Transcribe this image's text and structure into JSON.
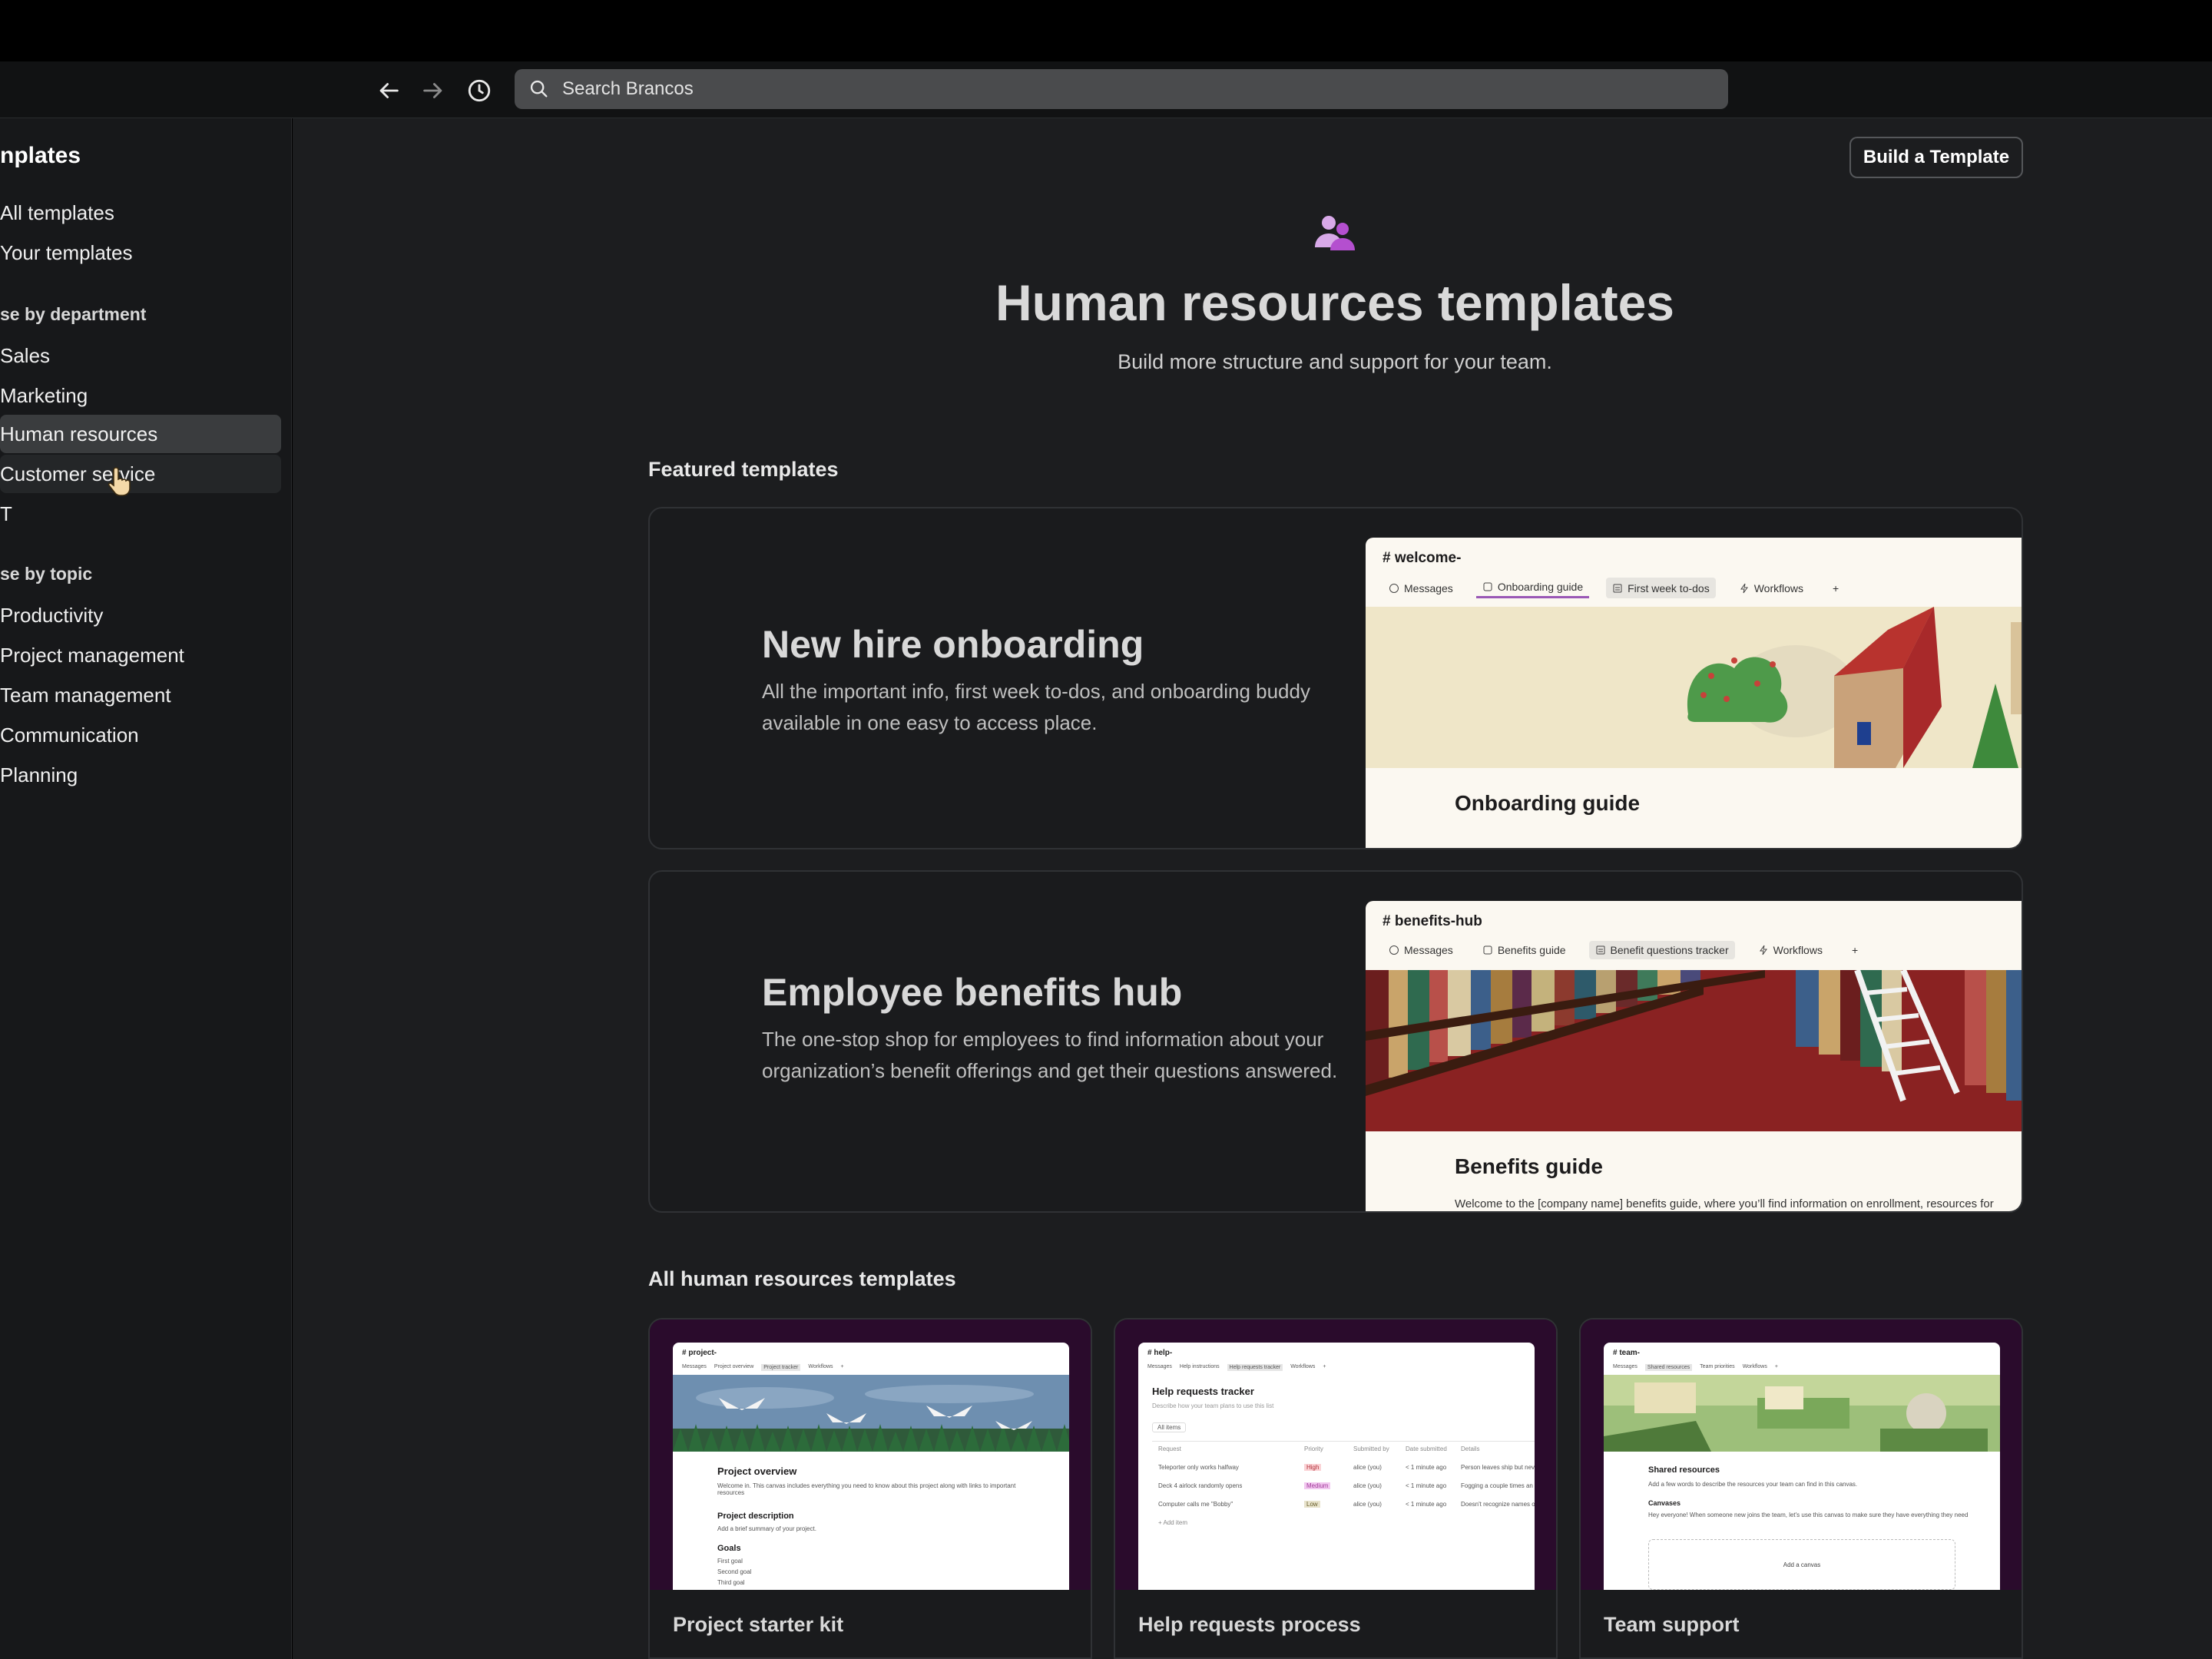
{
  "toolbar": {
    "search_placeholder": "Search Brancos"
  },
  "sidebar": {
    "title": "nplates",
    "top_items": [
      "All templates",
      "Your templates"
    ],
    "dept_heading": "se by department",
    "dept_items": [
      "Sales",
      "Marketing",
      "Human resources",
      "Customer service",
      "T"
    ],
    "topic_heading": "se by topic",
    "topic_items": [
      "Productivity",
      "Project management",
      "Team management",
      "Communication",
      "Planning"
    ]
  },
  "header": {
    "build_button": "Build a Template",
    "hero_icon": "people-icon",
    "title": "Human resources templates",
    "subtitle": "Build more structure and support for your team."
  },
  "featured": {
    "heading": "Featured templates",
    "cards": [
      {
        "title": "New hire onboarding",
        "description": "All the important info, first week to-dos, and onboarding buddy available in one easy to access place.",
        "preview": {
          "channel": "# welcome-",
          "tabs": [
            "Messages",
            "Onboarding guide",
            "First week to-dos",
            "Workflows",
            "+"
          ],
          "doc_title": "Onboarding guide",
          "doc_line": ""
        }
      },
      {
        "title": "Employee benefits hub",
        "description": "The one-stop shop for employees to find information about your organization’s benefit offerings and get their questions answered.",
        "preview": {
          "channel": "# benefits-hub",
          "tabs": [
            "Messages",
            "Benefits guide",
            "Benefit questions tracker",
            "Workflows",
            "+"
          ],
          "doc_title": "Benefits guide",
          "doc_line": "Welcome to the [company name] benefits guide, where you’ll find information on enrollment, resources for"
        }
      }
    ]
  },
  "all_templates": {
    "heading": "All human resources templates",
    "cards": [
      {
        "name": "Project starter kit",
        "shot": {
          "channel": "# project-",
          "tabs": [
            "Messages",
            "Project overview",
            "Project tracker",
            "Workflows",
            "+"
          ],
          "h1": "Project overview",
          "t1": "Welcome in. This canvas includes everything you need to know about this project along with links to important resources",
          "h2": "Project description",
          "t2": "Add a brief summary of your project.",
          "h3": "Goals",
          "list": [
            "First goal",
            "Second goal",
            "Third goal"
          ]
        }
      },
      {
        "name": "Help requests process",
        "shot": {
          "channel": "# help-",
          "tabs": [
            "Messages",
            "Help instructions",
            "Help requests tracker",
            "Workflows",
            "+"
          ],
          "h1": "Help requests tracker",
          "t1": "Describe how your team plans to use this list",
          "columns": [
            "Request",
            "Priority",
            "Submitted by",
            "Date submitted",
            "Details"
          ],
          "rows": [
            [
              "Teleporter only works halfway",
              "High",
              "alice (you)",
              "< 1 minute ago",
              "Person leaves ship but never"
            ],
            [
              "Deck 4 airlock randomly opens",
              "Medium",
              "alice (you)",
              "< 1 minute ago",
              "Fogging a couple times an hour"
            ],
            [
              "Computer calls me \"Bobby\"",
              "Low",
              "alice (you)",
              "< 1 minute ago",
              "Doesn't recognize names of any"
            ]
          ],
          "add": "+ Add item",
          "view": "All items"
        }
      },
      {
        "name": "Team support",
        "shot": {
          "channel": "# team-",
          "tabs": [
            "Messages",
            "Shared resources",
            "Team priorities",
            "Workflows",
            "+"
          ],
          "h1": "Shared resources",
          "t1": "Add a few words to describe the resources your team can find in this canvas.",
          "h2": "Canvases",
          "t2": "Hey everyone! When someone new joins the team, let's use this canvas to make sure they have everything they need",
          "add": "Add a canvas"
        }
      }
    ]
  }
}
